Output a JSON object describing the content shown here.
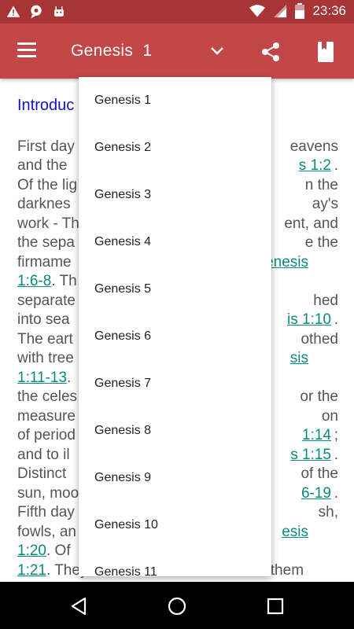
{
  "status_bar": {
    "time": "23:36",
    "notification_icons": [
      "warning-icon",
      "chat-icon",
      "android-icon"
    ],
    "system_icons": [
      "wifi-icon",
      "signal-icon",
      "battery-icon"
    ]
  },
  "app_bar": {
    "title": "Genesis  1",
    "menu_icon": "hamburger-icon",
    "dropdown_icon": "chevron-down-icon",
    "share_icon": "share-icon",
    "bookmark_icon": "book-icon",
    "color": "#c44747",
    "status_color": "#a73535"
  },
  "content": {
    "heading": "Introduc",
    "lines": [
      [
        "First day",
        "",
        "eavens"
      ],
      [
        "and the",
        "s 1:2",
        "."
      ],
      [
        "Of the lig",
        "",
        "n the"
      ],
      [
        "darknes",
        "",
        "ay's"
      ],
      [
        "work - Th",
        "",
        "ent, and"
      ],
      [
        "the sepa",
        "",
        "e the"
      ],
      [
        "firmame",
        "enesis",
        ""
      ],
      [
        "",
        "1:6-8",
        ". Th"
      ],
      [
        "separate",
        "",
        "hed"
      ],
      [
        "into sea",
        "is 1:10",
        "."
      ],
      [
        "The eart",
        "",
        "othed"
      ],
      [
        "with tree",
        "sis",
        ""
      ],
      [
        "",
        "1:11-13",
        "."
      ],
      [
        "the celes",
        "",
        "or the"
      ],
      [
        "measure",
        "",
        "on"
      ],
      [
        "of period",
        "1:14",
        ";"
      ],
      [
        "and to il",
        "s 1:15",
        "."
      ],
      [
        "Distinct",
        "",
        "of the"
      ],
      [
        "sun, moo",
        "6-19",
        "."
      ],
      [
        "Fifth day",
        "",
        "sh,"
      ],
      [
        "fowls, an",
        "esis",
        ""
      ],
      [
        "",
        "1:20",
        ". Of"
      ],
      [
        "",
        "1:21",
        ". They are blessed so as to make them"
      ]
    ]
  },
  "dropdown": {
    "items": [
      "Genesis 1",
      "Genesis 2",
      "Genesis 3",
      "Genesis 4",
      "Genesis 5",
      "Genesis 6",
      "Genesis 7",
      "Genesis 8",
      "Genesis 9",
      "Genesis 10",
      "Genesis 11"
    ]
  },
  "nav_bar": {
    "buttons": [
      "back-icon",
      "home-icon",
      "recents-icon"
    ]
  }
}
